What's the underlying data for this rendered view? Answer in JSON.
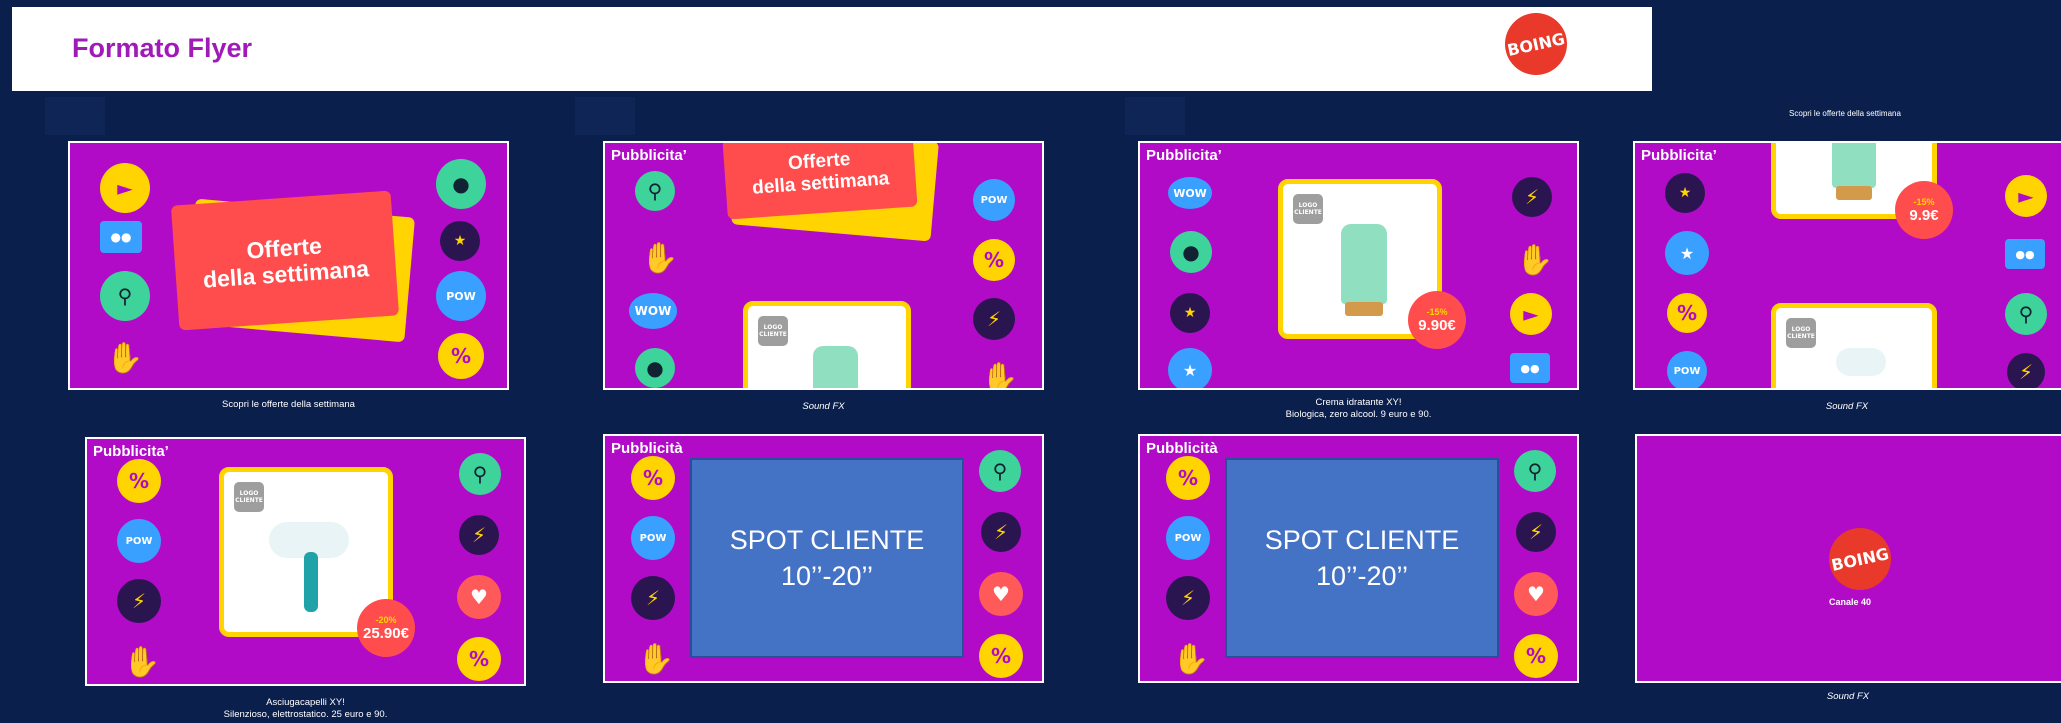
{
  "header": {
    "title": "Formato Flyer",
    "logo_text": "BOING"
  },
  "slides": [
    {
      "offer_line1": "Offerte",
      "offer_line2": "della settimana",
      "caption": "Scopri le offerte della settimana"
    },
    {
      "pub": "Pubblicita’",
      "offer_line1": "Offerte",
      "offer_line2": "della settimana",
      "logo_cliente": "LOGO CLIENTE",
      "caption": "Sound FX"
    },
    {
      "pub": "Pubblicita’",
      "logo_cliente": "LOGO CLIENTE",
      "price_pct": "-15%",
      "price": "9.90€",
      "caption_line1": "Crema idratante XY!",
      "caption_line2": "Biologica, zero alcool. 9 euro e 90."
    },
    {
      "pub": "Pubblicita’",
      "top_text": "Scopri le offerte della settimana",
      "price_pct": "-15%",
      "price": "9.9€",
      "logo_cliente": "LOGO CLIENTE",
      "caption": "Sound FX"
    },
    {
      "pub": "Pubblicita’",
      "logo_cliente": "LOGO CLIENTE",
      "price_pct": "-20%",
      "price": "25.90€",
      "caption_line1": "Asciugacapelli XY!",
      "caption_line2": "Silenzioso, elettrostatico. 25 euro e 90."
    },
    {
      "pub": "Pubblicità",
      "spot_line1": "SPOT CLIENTE",
      "spot_line2": "10’’-20’’"
    },
    {
      "pub": "Pubblicità",
      "spot_line1": "SPOT CLIENTE",
      "spot_line2": "10’’-20’’"
    },
    {
      "logo_text": "BOING",
      "channel": "Canale 40",
      "caption": "Sound FX"
    }
  ],
  "stickers": {
    "percent": "%",
    "hand": "✋",
    "bolt": "⚡",
    "heart": "♥",
    "wow": "WOW",
    "search": "⚲",
    "pow": "POW",
    "star": "★",
    "megaphone": "📢"
  },
  "colors": {
    "background": "#0b1f4d",
    "slide": "#b10bc8",
    "brand": "#a01ab8",
    "logo": "#e8392b",
    "spot": "#4472c4"
  }
}
